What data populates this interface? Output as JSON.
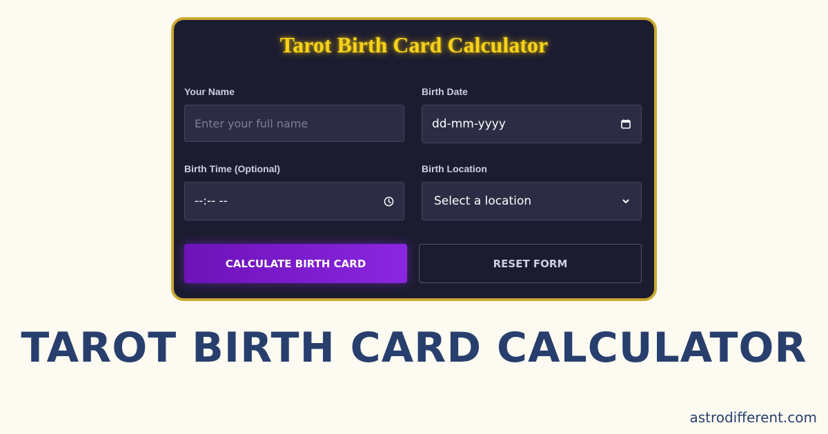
{
  "card": {
    "title": "Tarot Birth Card Calculator",
    "fields": {
      "name": {
        "label": "Your Name",
        "placeholder": "Enter your full name"
      },
      "date": {
        "label": "Birth Date",
        "value": "dd-mm-yyyy",
        "icon": "calendar-icon"
      },
      "time": {
        "label": "Birth Time (Optional)",
        "value": "--:-- --",
        "icon": "clock-icon"
      },
      "location": {
        "label": "Birth Location",
        "value": "Select a location",
        "icon": "chevron-down-icon"
      }
    },
    "buttons": {
      "calculate": "CALCULATE BIRTH CARD",
      "reset": "RESET FORM"
    }
  },
  "headline": "TAROT BIRTH CARD CALCULATOR",
  "site": "astrodifferent.com",
  "colors": {
    "background": "#fdfaf1",
    "card_bg": "#1c1c30",
    "card_border": "#c9a932",
    "title": "#f7d21c",
    "accent": "#8a26e0",
    "headline": "#283f6e"
  }
}
